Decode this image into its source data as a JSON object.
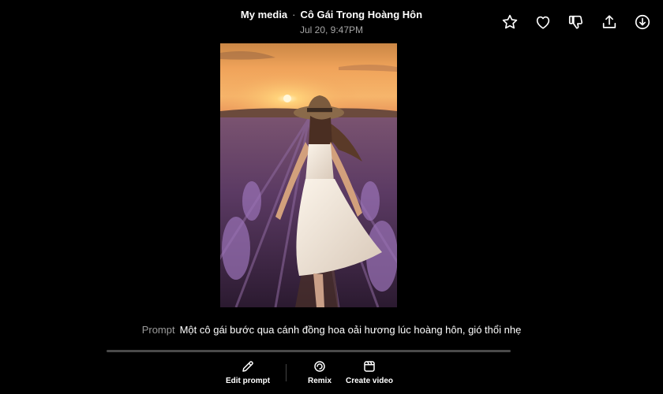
{
  "header": {
    "breadcrumb_parent": "My media",
    "separator": "·",
    "title": "Cô Gái Trong Hoàng Hôn",
    "timestamp": "Jul 20, 9:47PM"
  },
  "actions": [
    {
      "icon": "star-icon"
    },
    {
      "icon": "heart-icon"
    },
    {
      "icon": "thumbs-down-icon"
    },
    {
      "icon": "share-icon"
    },
    {
      "icon": "download-icon"
    }
  ],
  "prompt": {
    "label": "Prompt",
    "text": "Một cô gái bước qua cánh đồng hoa oải hương lúc hoàng hôn, gió thổi nhẹ"
  },
  "toolbar": {
    "edit_prompt": "Edit prompt",
    "remix": "Remix",
    "create_video": "Create video"
  }
}
